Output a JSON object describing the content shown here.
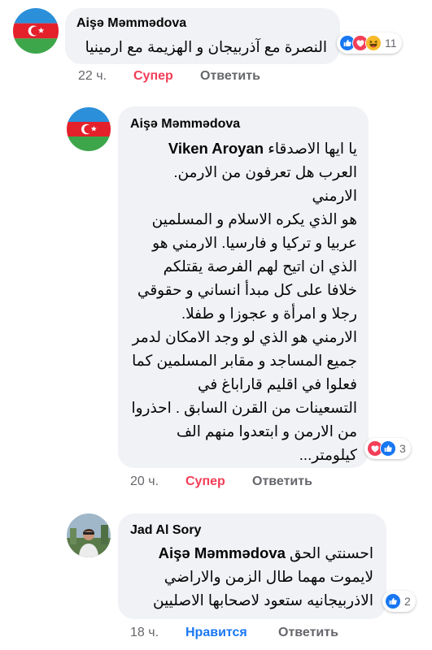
{
  "comments": [
    {
      "author": "Aişə Məmmədova",
      "text": "النصرة مع آذربيجان و الهزيمة مع ارمينيا",
      "reaction_count": "11",
      "reaction_icons": [
        "like-icon",
        "love-icon",
        "haha-icon"
      ],
      "time": "22 ч.",
      "react_label": "Супер",
      "react_color": "#f33e58",
      "reply_label": "Ответить",
      "avatar": "azerbaijan-flag-avatar"
    },
    {
      "author": "Aişə Məmmədova",
      "mention": "Viken Aroyan",
      "text_lines": [
        "يا ايها الاصدقاء",
        "العرب هل تعرفون من الارمن. الارمني",
        "هو الذي يكره الاسلام و المسلمين",
        "عربيا و تركيا و فارسيا. الارمني هو",
        "الذي ان اتيح لهم الفرصة يقتلكم",
        "خلافا على كل مبدأ انساني و حقوقي",
        "رجلا و امرأة و عجوزا و طفلا.",
        "الارمني هو الذي لو وجد الامكان لدمر",
        "جميع المساجد و مقابر المسلمين كما",
        "فعلوا في اقليم قاراباغ في",
        "التسعينات من القرن السابق . احذروا",
        "من الارمن و ابتعدوا منهم الف",
        "كيلومتر..."
      ],
      "reaction_count": "3",
      "reaction_icons": [
        "love-icon",
        "like-icon"
      ],
      "time": "20 ч.",
      "react_label": "Супер",
      "react_color": "#f33e58",
      "reply_label": "Ответить",
      "avatar": "azerbaijan-flag-avatar"
    },
    {
      "author": "Jad Al Sory",
      "mention": "Aişə Məmmədova",
      "text_lines": [
        "احسنتي الحق",
        "لايموت مهما طال الزمن والاراضي",
        "الاذربيجانيه ستعود لاصحابها الاصليين"
      ],
      "reaction_count": "2",
      "reaction_icons": [
        "like-icon"
      ],
      "time": "18 ч.",
      "react_label": "Нравится",
      "react_color": "#1877f2",
      "reply_label": "Ответить",
      "avatar": "man-photo-avatar"
    }
  ],
  "colors": {
    "bubble": "#f0f2f5",
    "like": "#1877f2",
    "love": "#f33e58",
    "haha": "#f7b928",
    "meta": "#65676b"
  }
}
